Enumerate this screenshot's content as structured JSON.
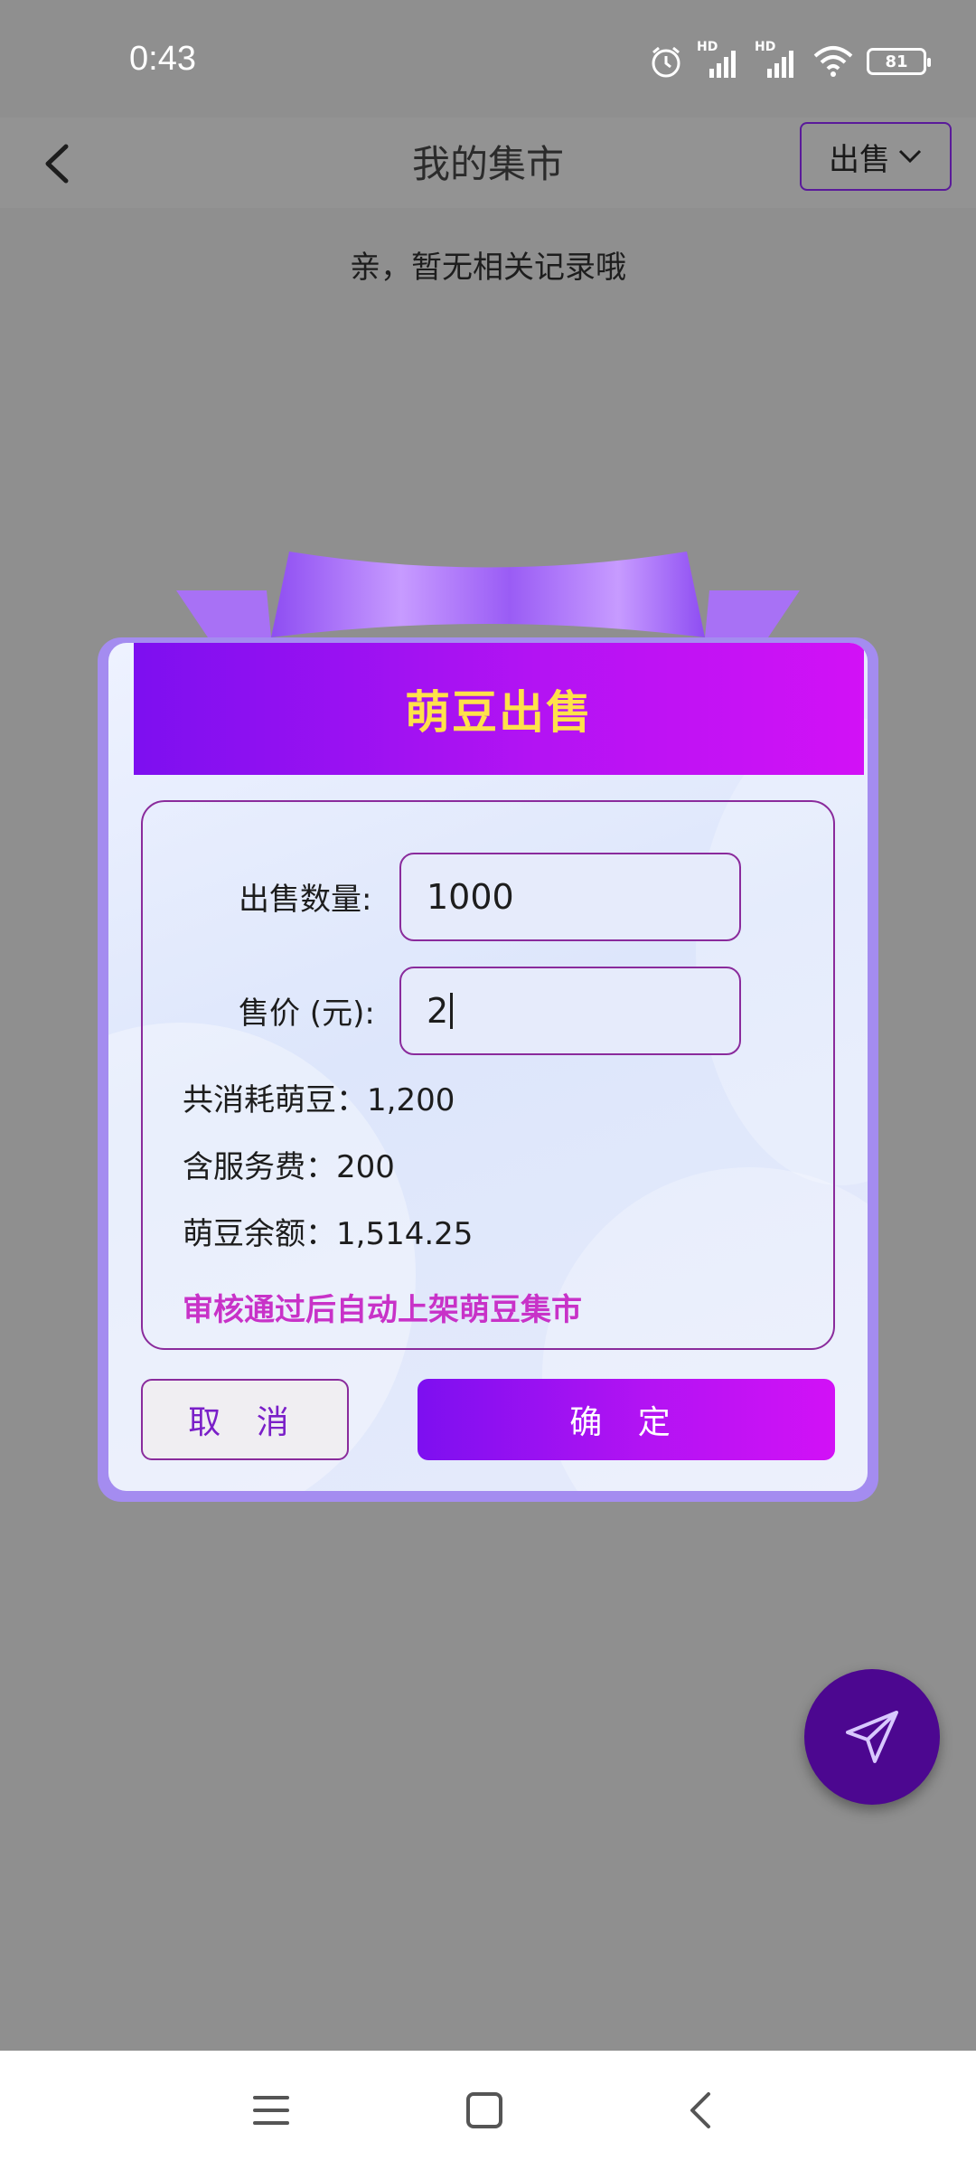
{
  "status_bar": {
    "time": "0:43",
    "battery": "81",
    "network_labels": [
      "HD",
      "HD"
    ]
  },
  "header": {
    "title": "我的集市",
    "dropdown_label": "出售"
  },
  "empty_message": "亲，暂无相关记录哦",
  "dialog": {
    "title": "萌豆出售",
    "quantity_label": "出售数量:",
    "quantity_value": "1000",
    "price_label": "售价 (元):",
    "price_value": "2",
    "total_cost": "共消耗萌豆：1,200",
    "service_fee": "含服务费：200",
    "balance": "萌豆余额：1,514.25",
    "notice": "审核通过后自动上架萌豆集市",
    "cancel_label": "取 消",
    "confirm_label": "确 定"
  },
  "colors": {
    "accent_start": "#7d0ff0",
    "accent_end": "#d211f6",
    "title_yellow": "#ffe14a",
    "notice_magenta": "#c832c8",
    "fab": "#4c0790"
  },
  "icons": [
    "back-arrow-icon",
    "chevron-down-icon",
    "send-icon",
    "menu-icon",
    "home-square-icon",
    "nav-back-icon",
    "alarm-icon",
    "signal-icon",
    "wifi-icon",
    "battery-icon"
  ]
}
